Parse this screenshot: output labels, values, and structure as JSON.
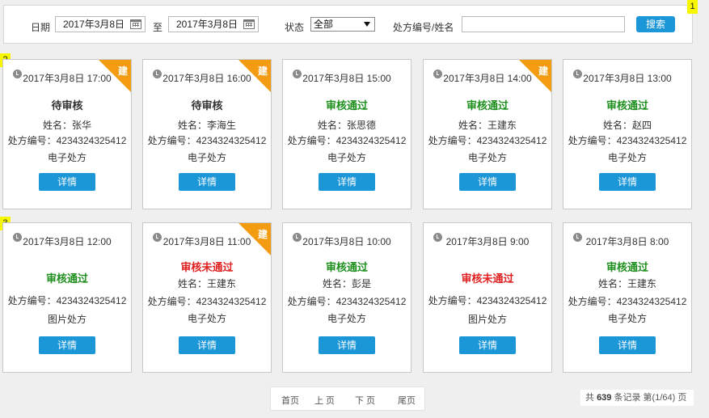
{
  "filter": {
    "date_label": "日期",
    "date_from": "2017年3月8日",
    "to_label": "至",
    "date_to": "2017年3月8日",
    "status_label": "状态",
    "status_value": "全部",
    "search_label": "处方编号/姓名",
    "search_value": "",
    "search_button": "搜索"
  },
  "markers": [
    "1",
    "2",
    "3"
  ],
  "cards": [
    {
      "time": "2017年3月8日 17:00",
      "status": "待审核",
      "tag": "建",
      "name": "姓名：张华",
      "rx_no": "处方编号：4234324325412",
      "rx_type": "电子处方",
      "button": "详情"
    },
    {
      "time": "2017年3月8日 16:00",
      "status": "待审核",
      "tag": "建",
      "name": "姓名：李海生",
      "rx_no": "处方编号：4234324325412",
      "rx_type": "电子处方",
      "button": "详情"
    },
    {
      "time": "2017年3月8日 15:00",
      "status": "审核通过",
      "tag": "",
      "name": "姓名：张思德",
      "rx_no": "处方编号：4234324325412",
      "rx_type": "电子处方",
      "button": "详情"
    },
    {
      "time": "2017年3月8日 14:00",
      "status": "审核通过",
      "tag": "建",
      "name": "姓名：王建东",
      "rx_no": "处方编号：4234324325412",
      "rx_type": "电子处方",
      "button": "详情"
    },
    {
      "time": "2017年3月8日 13:00",
      "status": "审核通过",
      "tag": "",
      "name": "姓名：赵四",
      "rx_no": "处方编号：4234324325412",
      "rx_type": "电子处方",
      "button": "详情"
    },
    {
      "time": "2017年3月8日 12:00",
      "status": "审核通过",
      "tag": "",
      "name": "",
      "rx_no": "处方编号：4234324325412",
      "rx_type": "图片处方",
      "button": "详情"
    },
    {
      "time": "2017年3月8日 11:00",
      "status": "审核未通过",
      "tag": "建",
      "name": "姓名：王建东",
      "rx_no": "处方编号：4234324325412",
      "rx_type": "电子处方",
      "button": "详情"
    },
    {
      "time": "2017年3月8日 10:00",
      "status": "审核通过",
      "tag": "",
      "name": "姓名：彭是",
      "rx_no": "处方编号：4234324325412",
      "rx_type": "电子处方",
      "button": "详情"
    },
    {
      "time": "2017年3月8日 9:00",
      "status": "审核未通过",
      "tag": "",
      "name": "",
      "rx_no": "处方编号：4234324325412",
      "rx_type": "图片处方",
      "button": "详情"
    },
    {
      "time": "2017年3月8日 8:00",
      "status": "审核通过",
      "tag": "",
      "name": "姓名：王建东",
      "rx_no": "处方编号：4234324325412",
      "rx_type": "电子处方",
      "button": "详情"
    }
  ],
  "pager": {
    "first": "首页",
    "prev": "上 页",
    "next": "下 页",
    "last": "尾页",
    "summary_prefix": "共",
    "total": "639",
    "summary_mid": "条记录 第(",
    "page": "1/64",
    "summary_suffix": ") 页"
  },
  "colors": {
    "accent": "#1b96d6",
    "ribbon": "#f39c12",
    "passed": "#1e8f1e",
    "failed": "#e02020",
    "marker": "#f7f700"
  },
  "icons": {
    "clock": "clock-icon",
    "calendar": "calendar-icon",
    "dropdown": "chevron-down-icon"
  }
}
